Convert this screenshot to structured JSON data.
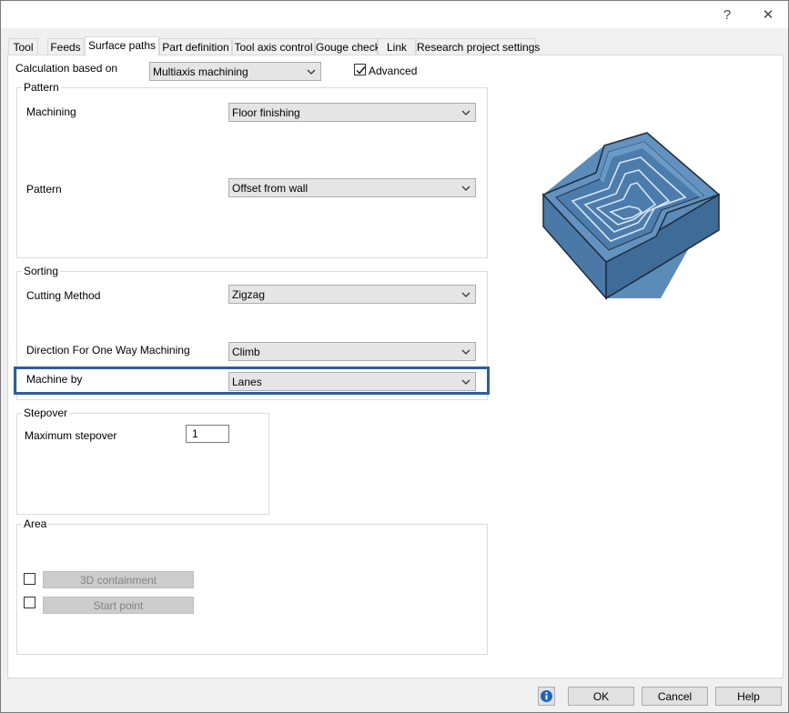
{
  "window": {
    "title": "",
    "help_glyph": "?",
    "close_glyph": "✕"
  },
  "tabs": [
    {
      "label": "Tool"
    },
    {
      "label": "Feeds"
    },
    {
      "label": "Surface paths"
    },
    {
      "label": "Part definition"
    },
    {
      "label": "Tool axis control"
    },
    {
      "label": "Gouge check"
    },
    {
      "label": "Link"
    },
    {
      "label": "Research project settings"
    }
  ],
  "active_tab": "Surface paths",
  "calc": {
    "label": "Calculation based on",
    "value": "Multiaxis machining",
    "advanced_label": "Advanced",
    "advanced_checked": true
  },
  "pattern_group": {
    "title": "Pattern",
    "machining_label": "Machining",
    "machining_value": "Floor finishing",
    "pattern_label": "Pattern",
    "pattern_value": "Offset from wall"
  },
  "sorting_group": {
    "title": "Sorting",
    "cutting_label": "Cutting Method",
    "cutting_value": "Zigzag",
    "direction_label": "Direction For One Way Machining",
    "direction_value": "Climb",
    "machine_by_label": "Machine by",
    "machine_by_value": "Lanes"
  },
  "stepover_group": {
    "title": "Stepover",
    "max_label": "Maximum stepover",
    "max_value": "1"
  },
  "area_group": {
    "title": "Area",
    "containment_label": "3D containment",
    "containment_checked": false,
    "start_point_label": "Start point",
    "start_point_checked": false
  },
  "footer": {
    "info_icon": "info-icon",
    "ok_label": "OK",
    "cancel_label": "Cancel",
    "help_label": "Help"
  },
  "colors": {
    "highlight": "#2e5f98",
    "part_fill": "#4f7fae",
    "part_edge": "#1c2b3a"
  }
}
